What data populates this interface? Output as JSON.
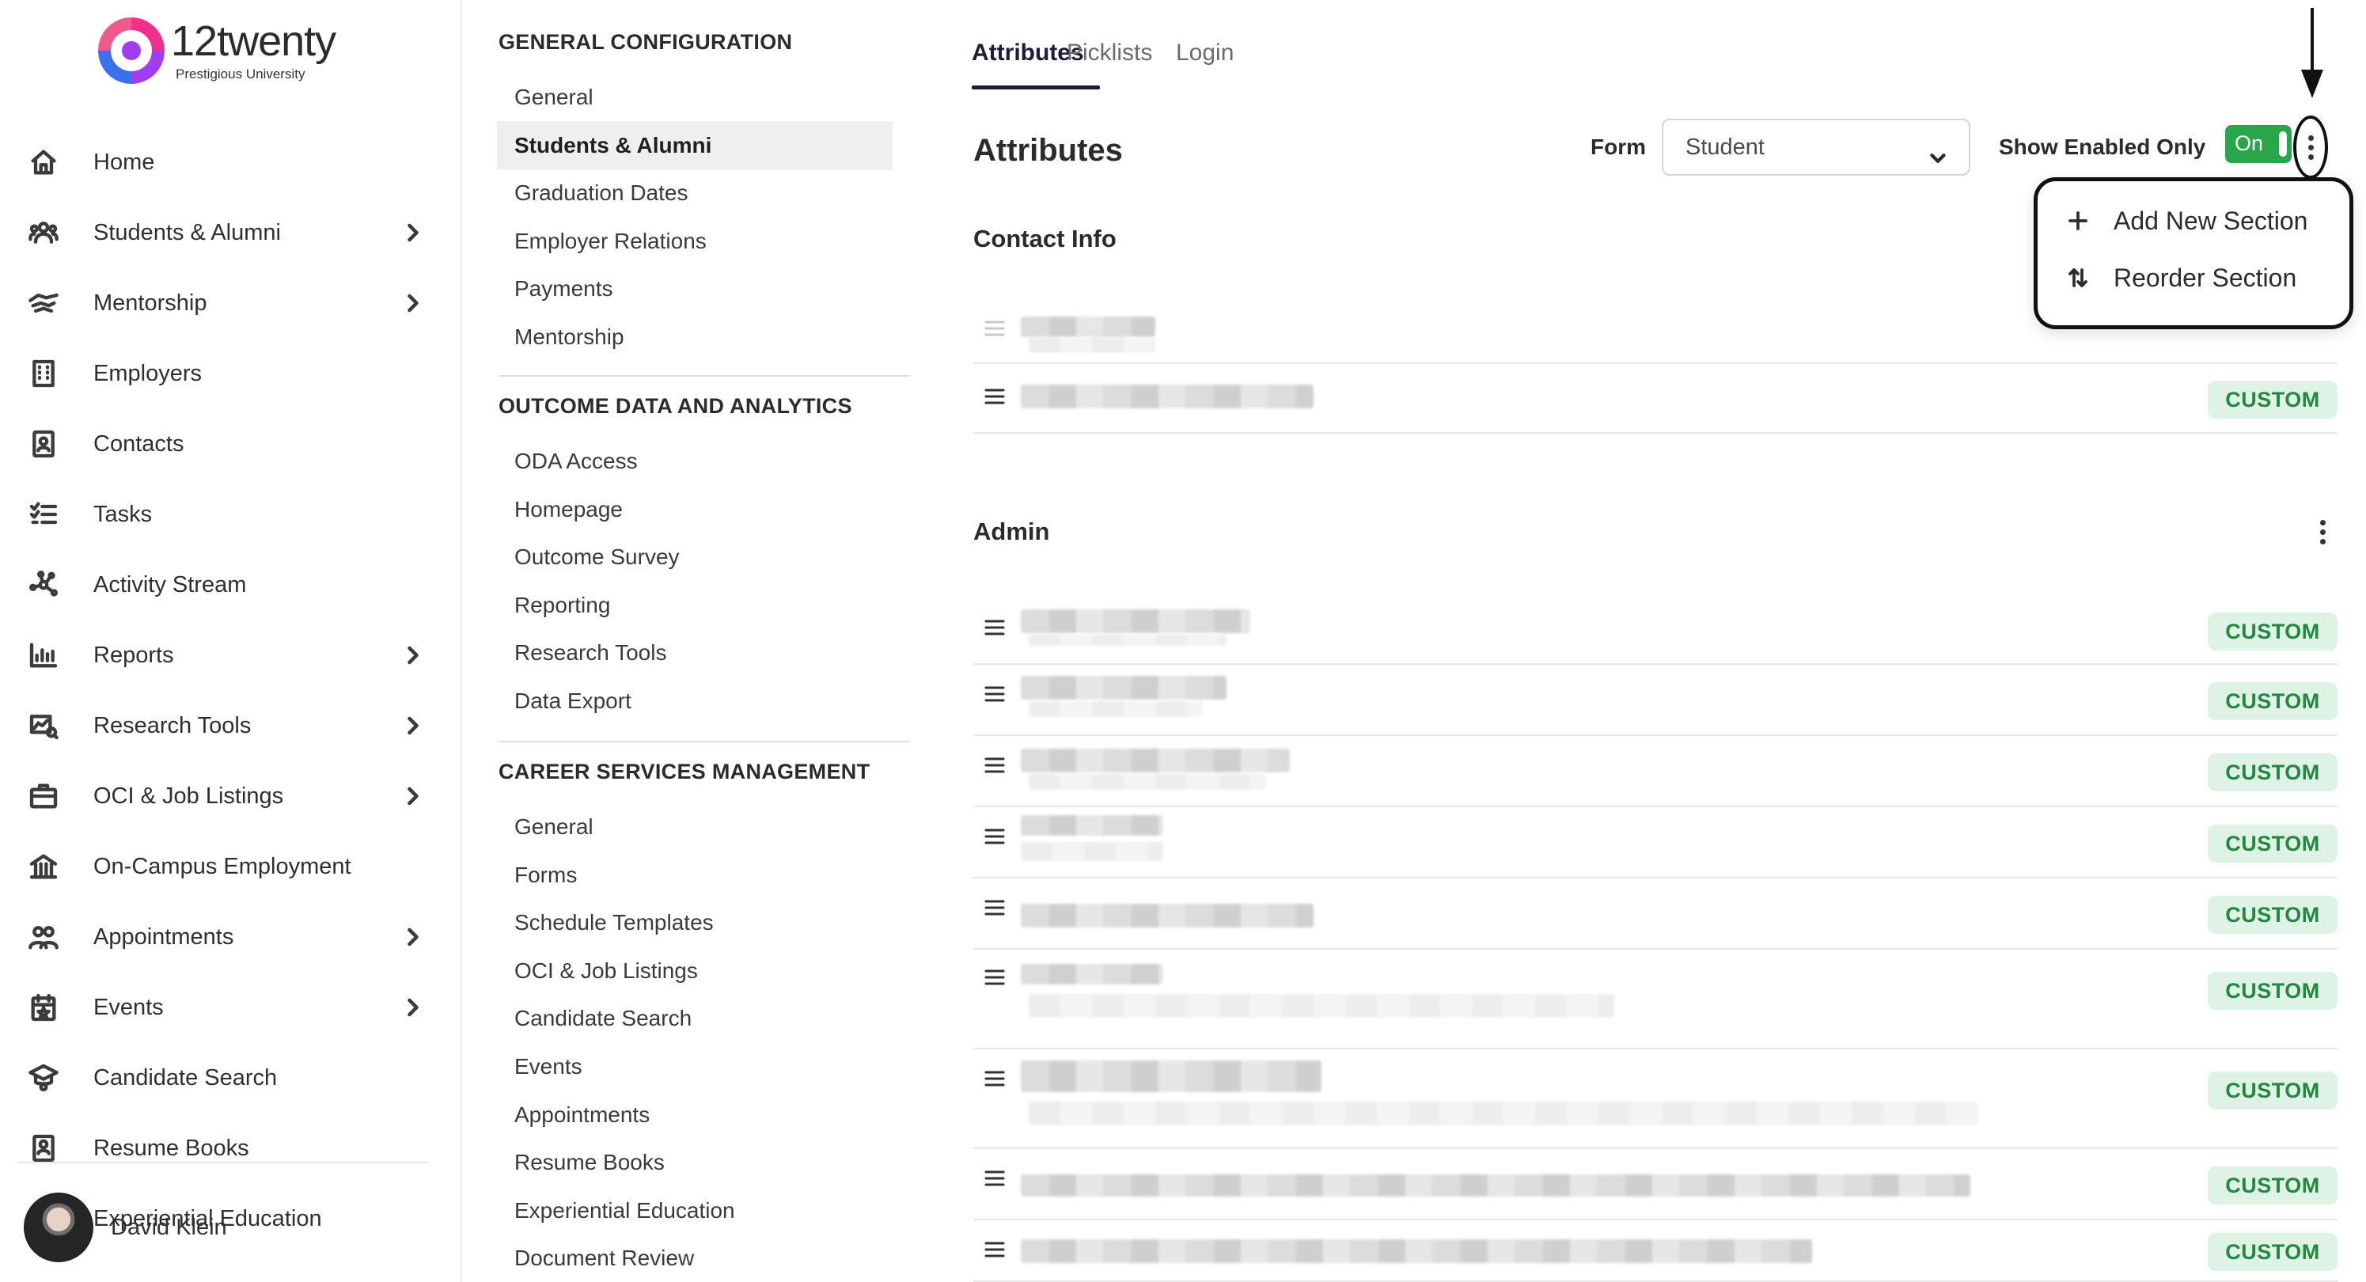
{
  "app": {
    "brand": "12twenty",
    "university": "Prestigious University"
  },
  "nav": {
    "items": [
      {
        "label": "Home",
        "icon": "home-icon",
        "chevron": false
      },
      {
        "label": "Students & Alumni",
        "icon": "users-icon",
        "chevron": true
      },
      {
        "label": "Mentorship",
        "icon": "handshake-icon",
        "chevron": true
      },
      {
        "label": "Employers",
        "icon": "building-icon",
        "chevron": false
      },
      {
        "label": "Contacts",
        "icon": "contact-card-icon",
        "chevron": false
      },
      {
        "label": "Tasks",
        "icon": "checklist-icon",
        "chevron": false
      },
      {
        "label": "Activity Stream",
        "icon": "network-icon",
        "chevron": false
      },
      {
        "label": "Reports",
        "icon": "bar-chart-icon",
        "chevron": true
      },
      {
        "label": "Research Tools",
        "icon": "research-icon",
        "chevron": true
      },
      {
        "label": "OCI & Job Listings",
        "icon": "briefcase-icon",
        "chevron": true
      },
      {
        "label": "On-Campus Employment",
        "icon": "campus-icon",
        "chevron": false
      },
      {
        "label": "Appointments",
        "icon": "people-icon",
        "chevron": true
      },
      {
        "label": "Events",
        "icon": "calendar-star-icon",
        "chevron": true
      },
      {
        "label": "Candidate Search",
        "icon": "graduate-search-icon",
        "chevron": false
      },
      {
        "label": "Resume Books",
        "icon": "resume-book-icon",
        "chevron": false
      },
      {
        "label": "Experiential Education",
        "icon": "location-pin-icon",
        "chevron": false
      }
    ],
    "user": {
      "name": "David Klein"
    }
  },
  "settings": {
    "sections": [
      {
        "title": "GENERAL CONFIGURATION",
        "items": [
          "General",
          "Students & Alumni",
          "Graduation Dates",
          "Employer Relations",
          "Payments",
          "Mentorship"
        ],
        "active": "Students & Alumni"
      },
      {
        "title": "OUTCOME DATA AND ANALYTICS",
        "items": [
          "ODA Access",
          "Homepage",
          "Outcome Survey",
          "Reporting",
          "Research Tools",
          "Data Export"
        ]
      },
      {
        "title": "CAREER SERVICES MANAGEMENT",
        "items": [
          "General",
          "Forms",
          "Schedule Templates",
          "OCI & Job Listings",
          "Candidate Search",
          "Events",
          "Appointments",
          "Resume Books",
          "Experiential Education",
          "Document Review"
        ]
      }
    ]
  },
  "main": {
    "tabs": [
      "Attributes",
      "Picklists",
      "Login"
    ],
    "active_tab": "Attributes",
    "title": "Attributes",
    "form_label": "Form",
    "form_value": "Student",
    "show_enabled_label": "Show Enabled Only",
    "toggle_label": "On",
    "toggle_on": true,
    "dropdown": {
      "items": [
        {
          "label": "Add New Section",
          "icon": "plus-icon"
        },
        {
          "label": "Reorder Section",
          "icon": "sort-arrows-icon"
        }
      ]
    },
    "sections": [
      {
        "title": "Contact Info",
        "badge": "CUSTOM",
        "row_count": 2
      },
      {
        "title": "Admin",
        "badge": "CUSTOM",
        "row_count": 9
      }
    ]
  },
  "colors": {
    "toggle_on": "#2aa64a",
    "badge_bg": "#dff2e6",
    "badge_text": "#23873f",
    "active_tab": "#1c1c3c"
  }
}
